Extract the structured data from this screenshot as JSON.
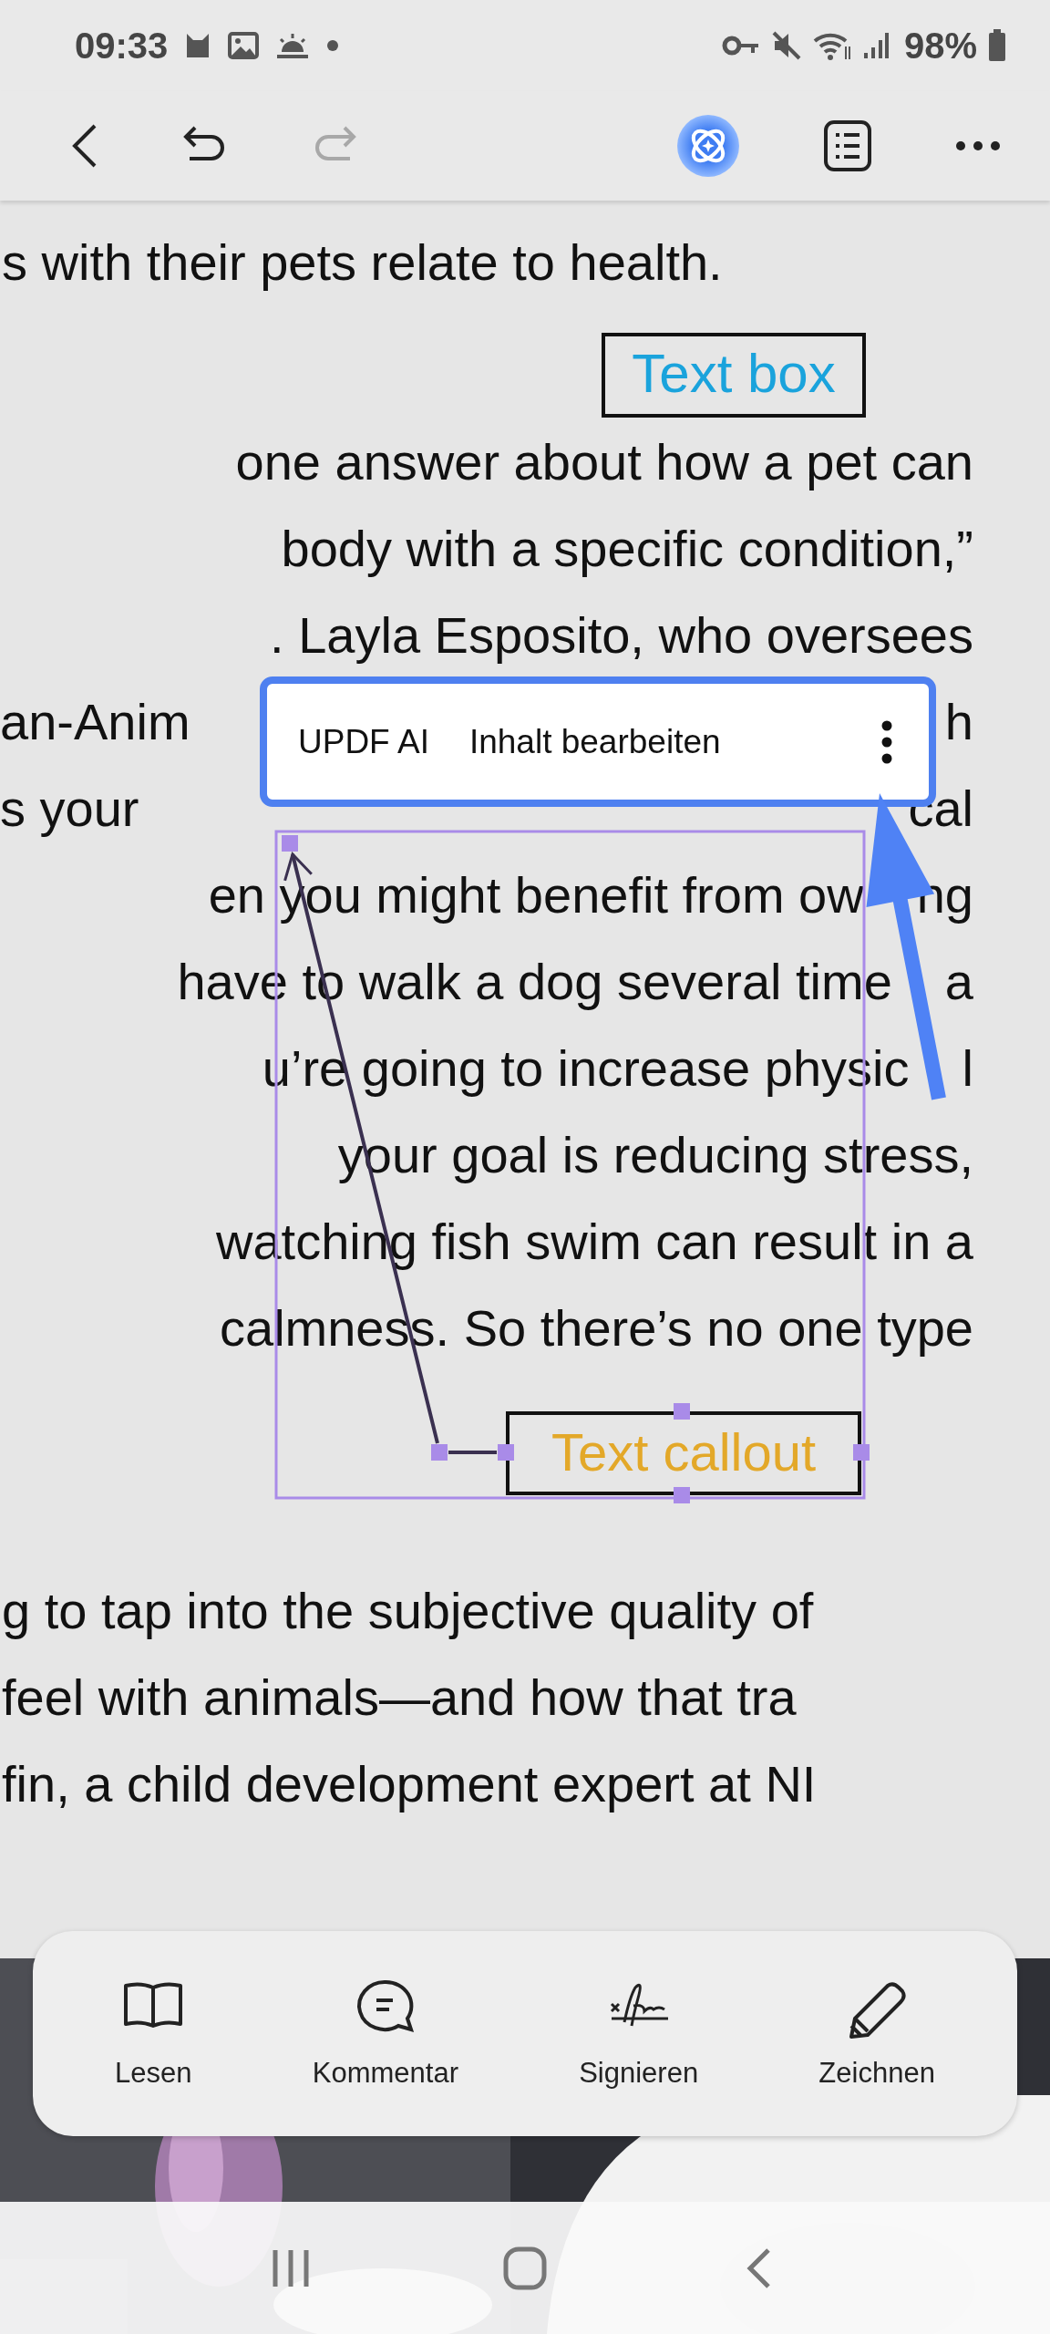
{
  "status_bar": {
    "time": "09:33",
    "battery": "98%"
  },
  "toolbar": {
    "redo_disabled": true
  },
  "document": {
    "paragraphs": [
      {
        "lines": [
          {
            "text": "s with their pets relate to health."
          }
        ]
      },
      {
        "lines": [
          {
            "text": "one answer about how a pet can"
          },
          {
            "text": "body with a specific condition,”"
          },
          {
            "text": ". Layla Esposito, who oversees"
          },
          {
            "kind": "split",
            "text": "an-Anim",
            "tail": "h"
          },
          {
            "kind": "split",
            "text": "s your",
            "tail": "cal"
          },
          {
            "kind": "gap",
            "text": "en you might benefit from ow",
            "tail": "ng"
          },
          {
            "kind": "gap",
            "text": "have to walk a dog several time",
            "tail": "a"
          },
          {
            "kind": "gap",
            "text": "u’re going to increase physic",
            "tail": "l"
          },
          {
            "text": "your goal is reducing stress,"
          },
          {
            "text": "watching fish swim can result in a"
          },
          {
            "text": "calmness. So there’s no one type"
          }
        ]
      },
      {
        "lines": [
          {
            "text": "g to tap into the subjective quality of"
          },
          {
            "text": "feel with animals—and how that tra"
          },
          {
            "text": "fin, a child development expert at NI"
          }
        ]
      }
    ],
    "text_box": {
      "text": "Text box"
    },
    "callout": {
      "text": "Text callout",
      "selected": true
    }
  },
  "context_menu": {
    "items": [
      {
        "label": "UPDF AI"
      },
      {
        "label": "Inhalt bearbeiten"
      }
    ]
  },
  "bottom_bar": {
    "items": [
      {
        "kind": "read",
        "label": "Lesen"
      },
      {
        "kind": "comment",
        "label": "Kommentar"
      },
      {
        "kind": "sign",
        "label": "Signieren"
      },
      {
        "kind": "draw",
        "label": "Zeichnen"
      }
    ]
  }
}
